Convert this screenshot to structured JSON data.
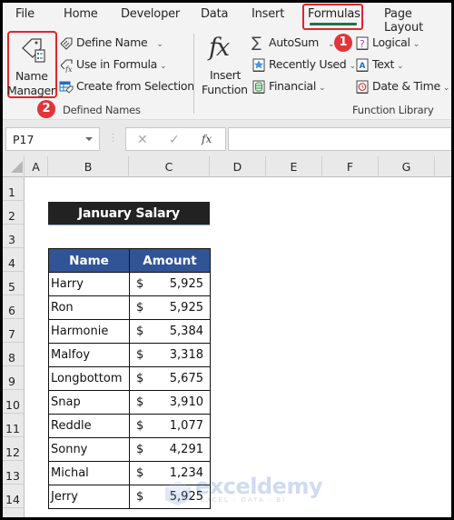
{
  "tabs": [
    {
      "label": "File",
      "active": false
    },
    {
      "label": "Home",
      "active": false
    },
    {
      "label": "Developer",
      "active": false
    },
    {
      "label": "Data",
      "active": false
    },
    {
      "label": "Insert",
      "active": false
    },
    {
      "label": "Formulas",
      "active": true
    },
    {
      "label": "Page Layout",
      "active": false
    }
  ],
  "ribbon": {
    "defined_names": {
      "group_label": "Defined Names",
      "name_manager_line1": "Name",
      "name_manager_line2": "Manager",
      "define_name": "Define Name",
      "use_in_formula": "Use in Formula",
      "create_from_selection": "Create from Selection"
    },
    "function_library": {
      "group_label": "Function Library",
      "insert_function_line1": "Insert",
      "insert_function_line2": "Function",
      "fx_glyph": "fx",
      "autosum": "AutoSum",
      "recently_used": "Recently Used",
      "financial": "Financial",
      "logical": "Logical",
      "text": "Text",
      "date_time": "Date & Time"
    }
  },
  "annotations": {
    "badge_1": "1",
    "badge_2": "2",
    "highlight_color": "#e0262b"
  },
  "formula_bar": {
    "name_box": "P17",
    "cancel_glyph": "✕",
    "enter_glyph": "✓",
    "fx_glyph": "fx",
    "formula": ""
  },
  "sheet": {
    "columns": [
      "A",
      "B",
      "C",
      "D",
      "E",
      "F",
      "G"
    ],
    "rows": [
      "1",
      "2",
      "3",
      "4",
      "5",
      "6",
      "7",
      "8",
      "9",
      "10",
      "11",
      "12",
      "13",
      "14"
    ],
    "title": "January Salary",
    "table": {
      "headers": [
        "Name",
        "Amount"
      ],
      "currency_symbol": "$",
      "rows": [
        {
          "name": "Harry",
          "amount": "5,925"
        },
        {
          "name": "Ron",
          "amount": "5,925"
        },
        {
          "name": "Harmonie",
          "amount": "5,384"
        },
        {
          "name": "Malfoy",
          "amount": "3,318"
        },
        {
          "name": "Longbottom",
          "amount": "5,675"
        },
        {
          "name": "Snap",
          "amount": "3,910"
        },
        {
          "name": "Reddle",
          "amount": "1,077"
        },
        {
          "name": "Sonny",
          "amount": "4,291"
        },
        {
          "name": "Michal",
          "amount": "1,234"
        },
        {
          "name": "Jerry",
          "amount": "5,925"
        }
      ],
      "header_color": "#305496",
      "title_color": "#222222"
    }
  },
  "watermark": {
    "brand": "exceldemy",
    "tagline": "EXCEL · DATA · BI"
  }
}
